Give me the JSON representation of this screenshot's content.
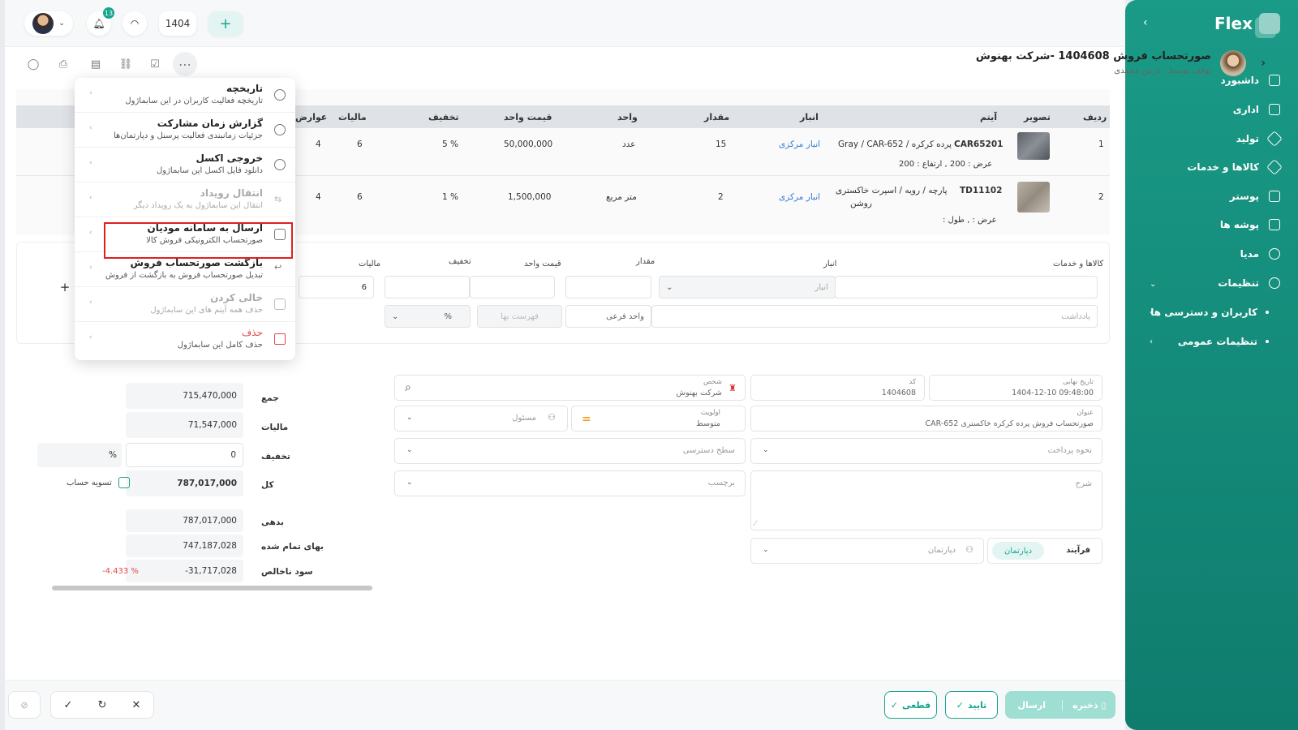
{
  "sidebar": {
    "brand": "Flex",
    "items": [
      {
        "label": "داشبورد",
        "icon": "home-icon"
      },
      {
        "label": "اداری",
        "icon": "office-icon"
      },
      {
        "label": "تولید",
        "icon": "production-icon"
      },
      {
        "label": "کالاها و خدمات",
        "icon": "products-icon"
      },
      {
        "label": "پوستر",
        "icon": "poster-icon"
      },
      {
        "label": "پوشه ها",
        "icon": "folder-icon"
      },
      {
        "label": "مدیا",
        "icon": "media-icon"
      },
      {
        "label": "تنظیمات",
        "icon": "gear-icon"
      }
    ],
    "sub_items": [
      {
        "label": "کاربران و دسترسی ها"
      },
      {
        "label": "تنظیمات عمومی"
      }
    ]
  },
  "topbar": {
    "notification_count": "13",
    "year": "1404"
  },
  "header": {
    "title": "صورتحساب فروش 1404608 -شرکت بهنوش",
    "subtitle": "توقف توسط : نازنین محمدی"
  },
  "table": {
    "headers": [
      "ردیف",
      "تصویر",
      "آیتم",
      "انبار",
      "مقدار",
      "واحد",
      "قیمت واحد",
      "تخفیف",
      "مالیات",
      "عوارض"
    ],
    "rows": [
      {
        "num": "1",
        "code": "CAR65201",
        "item": "پرده کرکره / Gray / CAR-652",
        "dims": "عرض : 200 ,  ارتفاع : 200",
        "warehouse": "انبار مرکزی",
        "qty": "15",
        "unit": "عدد",
        "price": "50,000,000",
        "discount": "5 %",
        "tax": "6",
        "duty": "4"
      },
      {
        "num": "2",
        "code": "TD11102",
        "item": "پارچه / رویه / اسپرت خاکستری",
        "item2": "روشن",
        "dims": "عرض : ,  طول :",
        "warehouse": "انبار مرکزی",
        "qty": "2",
        "unit": "متر مربع",
        "price": "1,500,000",
        "discount": "1 %",
        "tax": "6",
        "duty": "4"
      }
    ]
  },
  "entry": {
    "labels": {
      "products": "کالاها و خدمات",
      "warehouse": "انبار",
      "qty": "مقدار",
      "unit_price": "قیمت واحد",
      "discount": "تخفیف",
      "tax": "مالیات"
    },
    "warehouse_placeholder": "انبار",
    "tax_value": "6",
    "note_placeholder": "یادداشت",
    "sub_unit_placeholder": "واحد فرعی",
    "price_list_placeholder": "فهرست بها",
    "percent": "%"
  },
  "menu": {
    "items": [
      {
        "title": "تاریخچه",
        "sub": "تاریخچه فعالیت کاربران در این سابماژول"
      },
      {
        "title": "گزارش زمان مشارکت",
        "sub": "جزئیات زمانبندی فعالیت پرسنل و دپارتمان‌ها"
      },
      {
        "title": "خروجی اکسل",
        "sub": "دانلود فایل اکسل این سابماژول"
      },
      {
        "title": "انتقال رویداد",
        "sub": "انتقال این سابماژول به یک رویداد دیگر"
      },
      {
        "title": "ارسال به سامانه مودیان",
        "sub": "صورتحساب الکترونیکی فروش کالا"
      },
      {
        "title": "بازگشت صورتحساب فروش",
        "sub": "تبدیل صورتحساب فروش به بازگشت از فروش"
      },
      {
        "title": "خالی کردن",
        "sub": "حذف همه آیتم های این سابماژول"
      },
      {
        "title": "حذف",
        "sub": "حذف کامل این سابماژول"
      }
    ]
  },
  "form": {
    "final_date_label": "تاریخ نهایی",
    "final_date": "1404-12-10 09:48:00",
    "code_label": "کد",
    "code": "1404608",
    "person_label": "شخص",
    "person": "شرکت بهنوش",
    "title_label": "عنوان",
    "title_value": "صورتحساب فروش پرده کرکره خاکستری CAR-652",
    "priority_label": "اولویت",
    "priority": "متوسط",
    "responsible_placeholder": "مسئول",
    "payment_placeholder": "نحوه پرداخت",
    "access_placeholder": "سطح دسترسی",
    "description_placeholder": "شرح",
    "tag_placeholder": "برچسب",
    "process_tab": "فرآیند",
    "department_tab": "دپارتمان",
    "department_placeholder": "دپارتمان"
  },
  "totals": {
    "sum_label": "جمع",
    "sum": "715,470,000",
    "tax_label": "مالیات",
    "tax": "71,547,000",
    "discount_label": "تخفیف",
    "discount": "0",
    "discount_pct": "%",
    "total_label": "کل",
    "total": "787,017,000",
    "settle_label": "تسویه حساب",
    "debt_label": "بدهی",
    "debt": "787,017,000",
    "cost_label": "بهای تمام شده",
    "cost": "747,187,028",
    "gross_label": "سود ناخالص",
    "gross": "-31,717,028",
    "gross_pct": "-4.433 %"
  },
  "footer": {
    "save": "ذخیره",
    "send": "ارسال",
    "confirm": "تایید",
    "final": "قطعی"
  },
  "colors": {
    "accent": "#17a58e",
    "danger": "#e5484d",
    "highlight": "#e02020"
  }
}
